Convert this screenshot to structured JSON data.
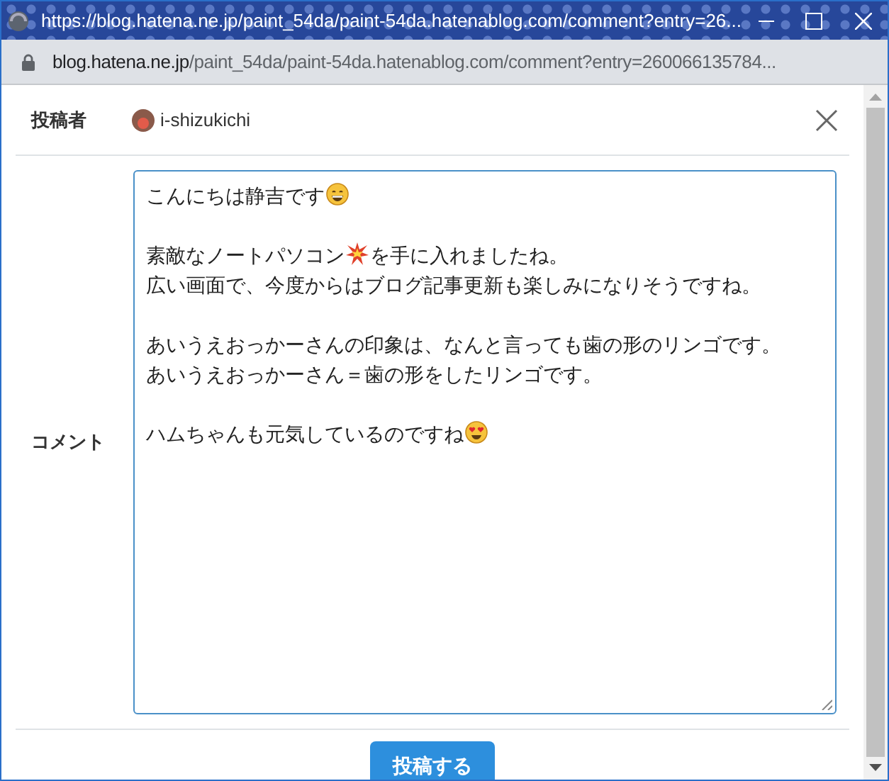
{
  "window": {
    "title": "https://blog.hatena.ne.jp/paint_54da/paint-54da.hatenablog.com/comment?entry=26..."
  },
  "address_bar": {
    "host": "blog.hatena.ne.jp",
    "path": "/paint_54da/paint-54da.hatenablog.com/comment?entry=260066135784..."
  },
  "author": {
    "label": "投稿者",
    "name": "i-shizukichi"
  },
  "comment": {
    "label": "コメント",
    "paragraphs": [
      [
        [
          {
            "kind": "text",
            "text": "こんにちは静吉です"
          },
          {
            "kind": "grin"
          }
        ]
      ],
      [
        [
          {
            "kind": "text",
            "text": "素敵なノートパソコン"
          },
          {
            "kind": "burst"
          },
          {
            "kind": "text",
            "text": "を手に入れましたね。"
          }
        ],
        [
          {
            "kind": "text",
            "text": "広い画面で、今度からはブログ記事更新も楽しみになりそうですね。"
          }
        ]
      ],
      [
        [
          {
            "kind": "text",
            "text": "あいうえおっかーさんの印象は、なんと言っても歯の形のリンゴです。"
          }
        ],
        [
          {
            "kind": "text",
            "text": "あいうえおっかーさん＝歯の形をしたリンゴです。"
          }
        ]
      ],
      [
        [
          {
            "kind": "text",
            "text": "ハムちゃんも元気しているのですね"
          },
          {
            "kind": "hearteyes"
          }
        ]
      ]
    ]
  },
  "submit": {
    "label": "投稿する"
  }
}
